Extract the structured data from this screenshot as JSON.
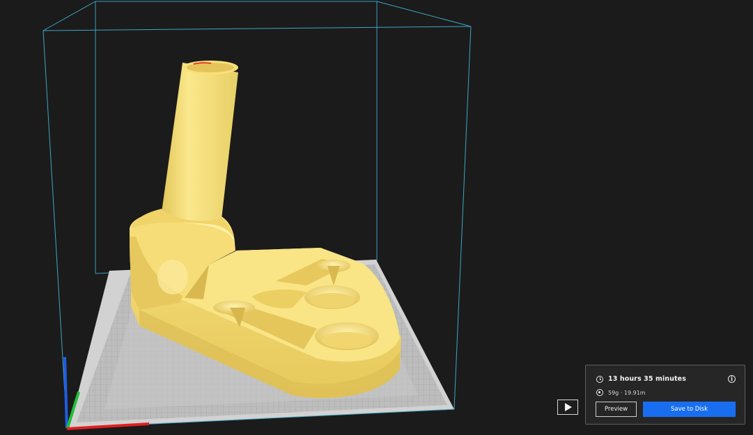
{
  "print_summary": {
    "print_time": "13 hours 35 minutes",
    "material_usage": "59g · 19.91m",
    "info_icon": "info-icon",
    "time_icon": "clock-icon",
    "material_icon": "spool-icon",
    "preview_label": "Preview",
    "save_label": "Save to Disk",
    "save_button_color": "#196ef0"
  },
  "viewport": {
    "background_color": "#1b1b1b",
    "build_volume_color": "#3ea6c4",
    "model_color": "#f7e27a",
    "axis_colors": {
      "x": "#e02020",
      "y": "#1fbf3a",
      "z": "#1e5ee6"
    },
    "play_icon": "play-icon"
  }
}
